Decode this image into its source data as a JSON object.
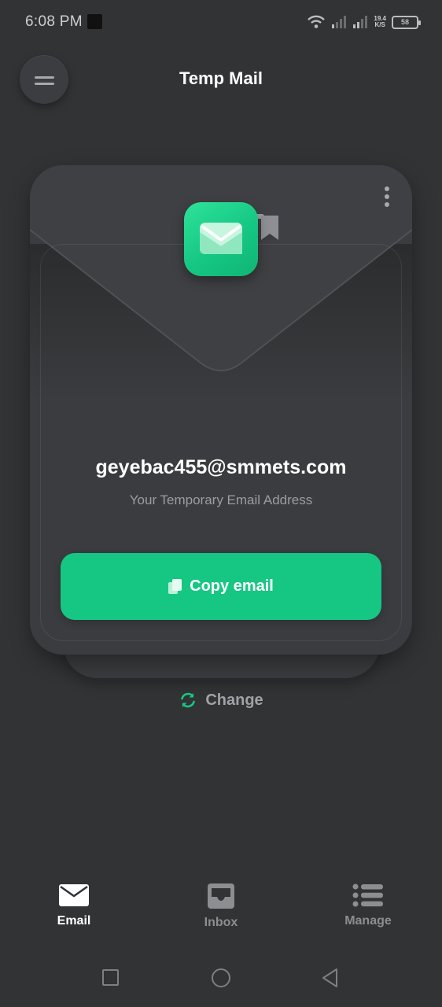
{
  "status_bar": {
    "time": "6:08 PM",
    "net_speed_value": "19.4",
    "net_speed_unit": "K/S",
    "battery": "58"
  },
  "app_bar": {
    "title": "Temp Mail",
    "menu_icon": "hamburger-menu-icon"
  },
  "card": {
    "more_icon": "more-vertical-icon",
    "logo_icon": "envelope-icon",
    "email": "geyebac455@smmets.com",
    "caption": "Your Temporary Email Address",
    "copy_button": {
      "label": "Copy email",
      "icon": "copy-icon"
    }
  },
  "change": {
    "label": "Change",
    "icon": "refresh-icon"
  },
  "bottom_nav": [
    {
      "label": "Email",
      "icon": "mail-icon",
      "active": true
    },
    {
      "label": "Inbox",
      "icon": "inbox-icon",
      "active": false
    },
    {
      "label": "Manage",
      "icon": "list-icon",
      "active": false
    }
  ],
  "colors": {
    "background": "#323335",
    "card": "#3b3c3f",
    "accent": "#16c784",
    "muted_text": "#9c9da1"
  }
}
